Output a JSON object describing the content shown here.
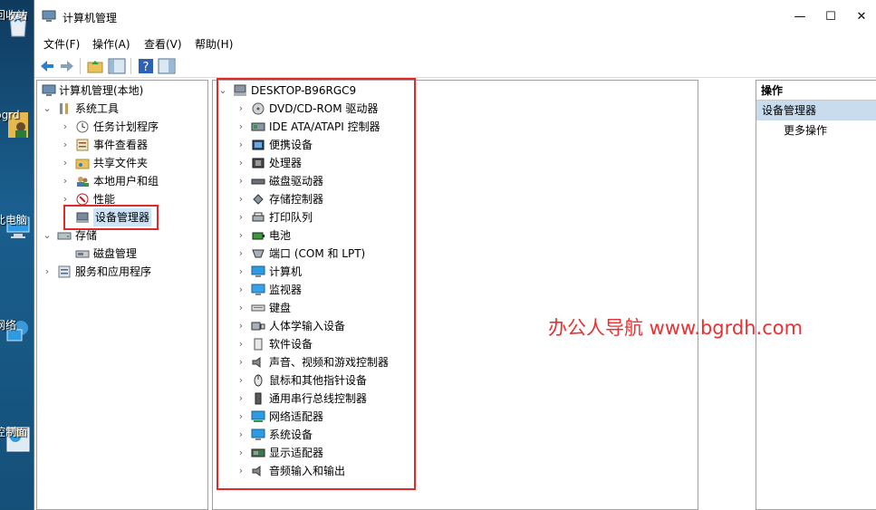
{
  "desktop": {
    "icons": [
      {
        "label": "回收站",
        "icon": "recycle-bin-icon"
      },
      {
        "label": "bgrd",
        "icon": "user-folder-icon"
      },
      {
        "label": "此电脑",
        "icon": "computer-icon"
      },
      {
        "label": "网络",
        "icon": "network-icon"
      },
      {
        "label": "控制面",
        "icon": "control-panel-icon"
      }
    ]
  },
  "window": {
    "title": "计算机管理",
    "controls": {
      "minimize": "—",
      "maximize": "☐",
      "close": "✕"
    }
  },
  "menu": {
    "file": "文件(F)",
    "action": "操作(A)",
    "view": "查看(V)",
    "help": "帮助(H)"
  },
  "left_tree": {
    "root": "计算机管理(本地)",
    "system_tools": "系统工具",
    "task_scheduler": "任务计划程序",
    "event_viewer": "事件查看器",
    "shared_folders": "共享文件夹",
    "local_users": "本地用户和组",
    "performance": "性能",
    "device_manager": "设备管理器",
    "storage": "存储",
    "disk_management": "磁盘管理",
    "services_apps": "服务和应用程序"
  },
  "device_tree": {
    "root": "DESKTOP-B96RGC9",
    "items": [
      {
        "label": "DVD/CD-ROM 驱动器",
        "icon": "dvd-drive-icon"
      },
      {
        "label": "IDE ATA/ATAPI 控制器",
        "icon": "ide-controller-icon"
      },
      {
        "label": "便携设备",
        "icon": "portable-device-icon"
      },
      {
        "label": "处理器",
        "icon": "processor-icon"
      },
      {
        "label": "磁盘驱动器",
        "icon": "disk-drive-icon"
      },
      {
        "label": "存储控制器",
        "icon": "storage-controller-icon"
      },
      {
        "label": "打印队列",
        "icon": "printer-icon"
      },
      {
        "label": "电池",
        "icon": "battery-icon"
      },
      {
        "label": "端口 (COM 和 LPT)",
        "icon": "port-icon"
      },
      {
        "label": "计算机",
        "icon": "computer-icon"
      },
      {
        "label": "监视器",
        "icon": "monitor-icon"
      },
      {
        "label": "键盘",
        "icon": "keyboard-icon"
      },
      {
        "label": "人体学输入设备",
        "icon": "hid-icon"
      },
      {
        "label": "软件设备",
        "icon": "software-device-icon"
      },
      {
        "label": "声音、视频和游戏控制器",
        "icon": "sound-icon"
      },
      {
        "label": "鼠标和其他指针设备",
        "icon": "mouse-icon"
      },
      {
        "label": "通用串行总线控制器",
        "icon": "usb-icon"
      },
      {
        "label": "网络适配器",
        "icon": "network-adapter-icon"
      },
      {
        "label": "系统设备",
        "icon": "system-device-icon"
      },
      {
        "label": "显示适配器",
        "icon": "display-adapter-icon"
      },
      {
        "label": "音频输入和输出",
        "icon": "audio-io-icon"
      }
    ]
  },
  "actions": {
    "header": "操作",
    "selected": "设备管理器",
    "more": "更多操作"
  },
  "watermark": "办公人导航 www.bgrdh.com",
  "colors": {
    "highlight_box": "#e0292b",
    "watermark": "#e53333",
    "selection": "#c9dcee"
  }
}
